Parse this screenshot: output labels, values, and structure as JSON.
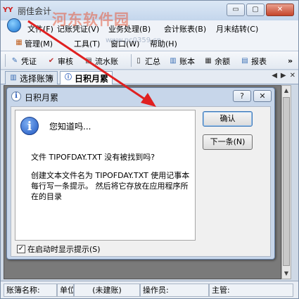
{
  "app": {
    "title": "丽佳会计",
    "logo_text": "YY"
  },
  "window_controls": {
    "minimize": "▭",
    "maximize": "▢",
    "close": "✕"
  },
  "menu": {
    "row1": [
      "文件(F)",
      "记账凭证(V)",
      "业务处理(B)",
      "会计账表(B)",
      "月末结转(C)"
    ],
    "row2": [
      "管理(M)",
      "工具(T)",
      "窗口(W)",
      "帮助(H)"
    ]
  },
  "toolbar": {
    "items": [
      {
        "label": "凭证",
        "icon": "voucher-icon"
      },
      {
        "label": "审核",
        "icon": "check-icon"
      },
      {
        "label": "流水账",
        "icon": "ledger-icon"
      },
      {
        "label": "汇总",
        "icon": "summary-icon"
      },
      {
        "label": "账本",
        "icon": "book-icon"
      },
      {
        "label": "余额",
        "icon": "balance-icon"
      },
      {
        "label": "报表",
        "icon": "report-icon"
      }
    ],
    "overflow": "»"
  },
  "tabs": [
    {
      "label": "选择账簿",
      "active": false
    },
    {
      "label": "日积月累",
      "active": true
    }
  ],
  "tab_nav": {
    "prev": "◀",
    "next": "▶",
    "close": "✕"
  },
  "dialog": {
    "title": "日积月累",
    "help": "?",
    "close": "✕",
    "heading": "您知道吗...",
    "line1": "文件 TIPOFDAY.TXT 没有被找到吗?",
    "paragraph": "创建文本文件名为 TIPOFDAY.TXT 使用记事本每行写一条提示。 然后将它存放在应用程序所在的目录",
    "ok_button": "确认",
    "next_button": "下一条(N)",
    "checkbox_label": "在启动时显示提示(S)",
    "checkbox_checked": true
  },
  "statusbar": {
    "account_label": "账簿名称:",
    "unit_label": "单位:",
    "unit_value": "(未建账)",
    "operator_label": "操作员:",
    "supervisor_label": "主管:"
  },
  "watermark": {
    "main": "河东软件园",
    "sub": "www.pc0359.cn"
  },
  "colors": {
    "arrow": "#e02020",
    "watermark": "#e65a3c"
  }
}
